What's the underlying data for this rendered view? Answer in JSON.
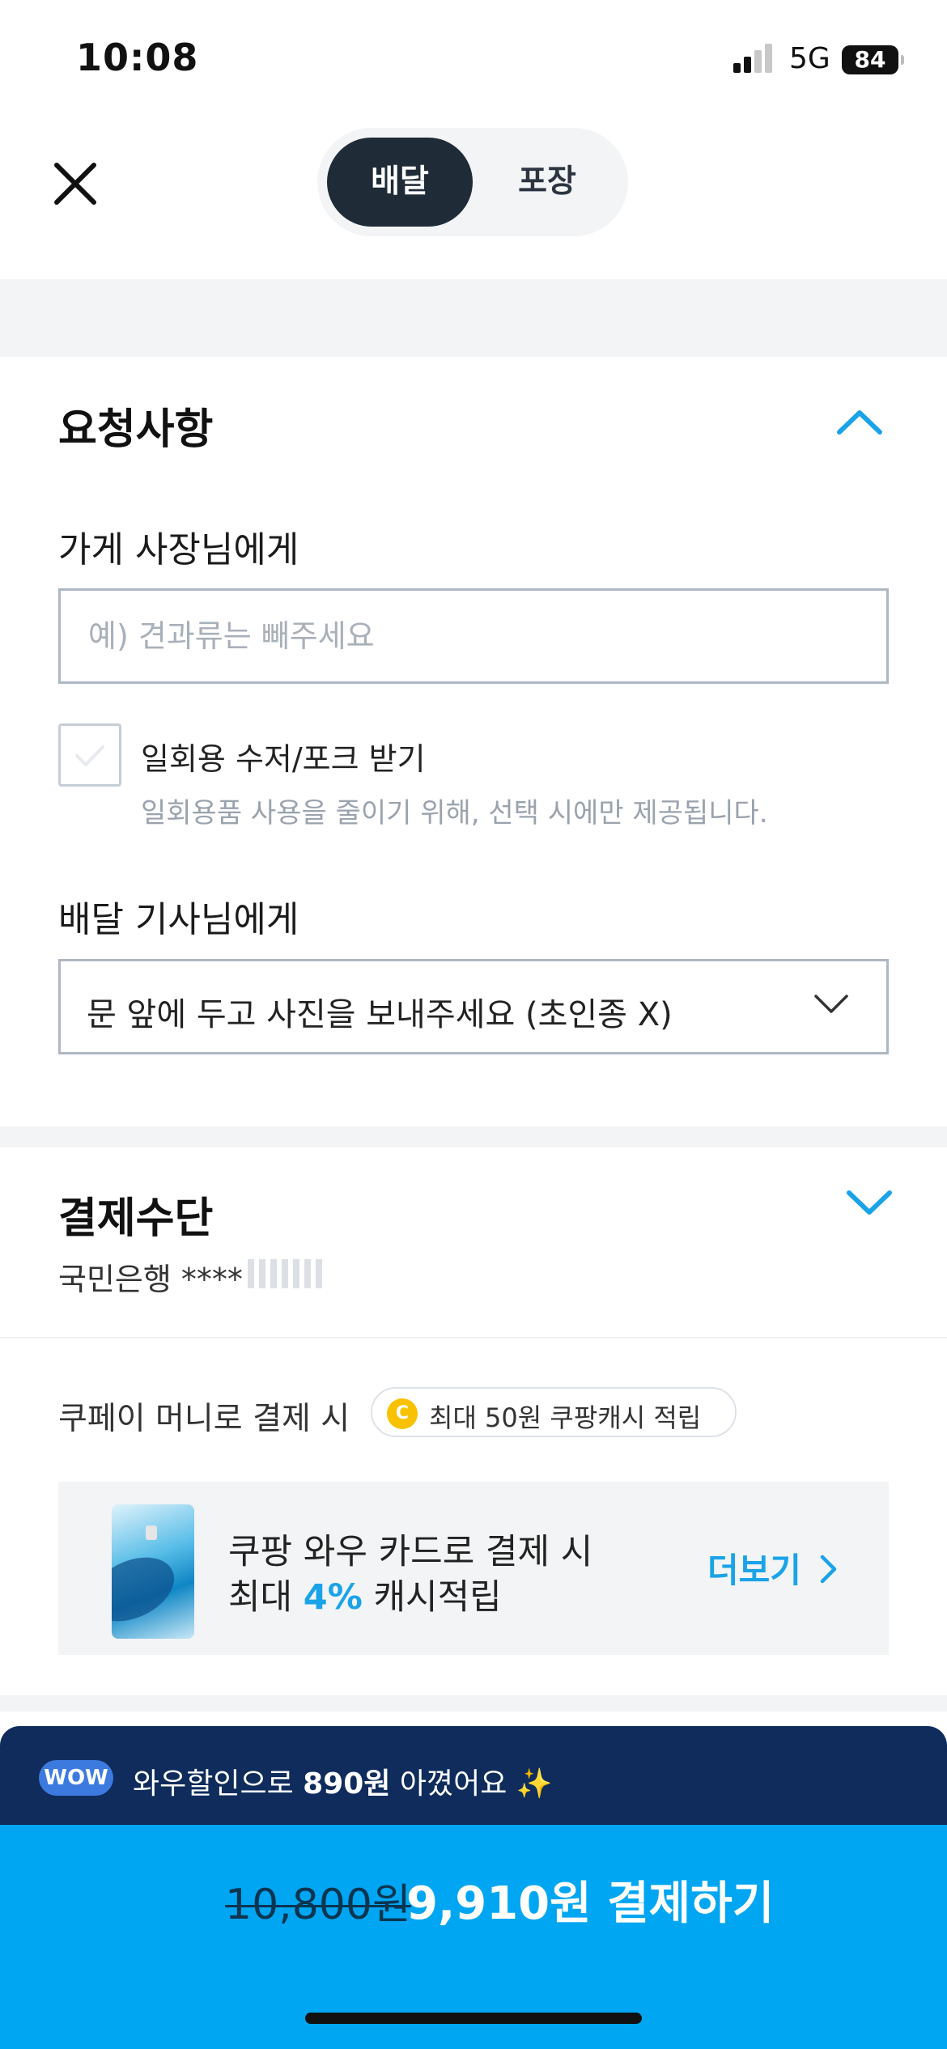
{
  "status_bar": {
    "time": "10:08",
    "network": "5G",
    "battery": "84"
  },
  "header": {
    "tabs": [
      {
        "label": "배달",
        "active": true
      },
      {
        "label": "포장",
        "active": false
      }
    ],
    "close_icon": "close-icon"
  },
  "request": {
    "title": "요청사항",
    "store_label": "가게 사장님에게",
    "store_placeholder": "예) 견과류는 빼주세요",
    "store_value": "",
    "utensils_label": "일회용 수저/포크 받기",
    "utensils_note": "일회용품 사용을 줄이기 위해, 선택 시에만 제공됩니다.",
    "utensils_checked": false,
    "rider_label": "배달 기사님에게",
    "rider_selected": "문 앞에 두고 사진을 보내주세요 (초인종 X)"
  },
  "payment": {
    "title": "결제수단",
    "method": "국민은행 ****",
    "coupay_label": "쿠페이 머니로 결제 시",
    "coin_glyph": "C",
    "cash_reward": "최대 50원 쿠팡캐시 적립",
    "promo": {
      "line1": "쿠팡 와우 카드로 결제 시",
      "line2_prefix": "최대 ",
      "line2_highlight": "4%",
      "line2_suffix": " 캐시적립",
      "more": "더보기"
    }
  },
  "wow": {
    "badge": "WOW",
    "text_prefix": "와우할인으로 ",
    "amount": "890원",
    "text_suffix": " 아꼈어요",
    "sparkle": "✨"
  },
  "checkout": {
    "original_price": "10,800원",
    "final_label": "9,910원 결제하기"
  },
  "colors": {
    "accent": "#00a6f2",
    "navy": "#0f2c5c",
    "dark_tab": "#1f2b36",
    "link_blue": "#1aa3e8"
  }
}
